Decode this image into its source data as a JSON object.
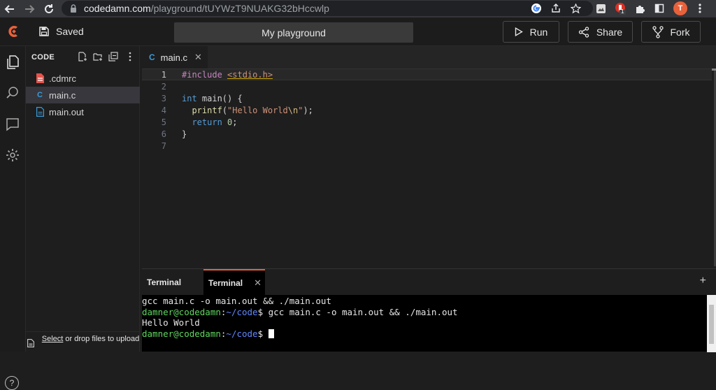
{
  "browser": {
    "url_host": "codedamn.com",
    "url_path": "/playground/tUYWzT9NUAKG32bHccwlp",
    "avatar_letter": "T",
    "extension_badge": "1"
  },
  "header": {
    "saved_label": "Saved",
    "title": "My playground",
    "run_label": "Run",
    "share_label": "Share",
    "fork_label": "Fork"
  },
  "explorer": {
    "title": "CODE",
    "files": [
      {
        "name": ".cdmrc",
        "icon": "file-red-icon"
      },
      {
        "name": "main.c",
        "icon": "c-file-icon"
      },
      {
        "name": "main.out",
        "icon": "file-blue-icon"
      }
    ],
    "upload_link": "Select",
    "upload_text": " or drop files to upload"
  },
  "editor": {
    "tab_label": "main.c",
    "line_numbers": [
      "1",
      "2",
      "3",
      "4",
      "5",
      "6",
      "7"
    ],
    "code": {
      "l1_pp": "#include ",
      "l1_inc": "<stdio.h>",
      "l3_kw": "int",
      "l3_rest": " main() {",
      "l4_fn": "printf",
      "l4_open": "(",
      "l4_str": "\"Hello World",
      "l4_esc": "\\n",
      "l4_strend": "\"",
      "l4_close": ");",
      "l5_kw": "return",
      "l5_num": "0",
      "l5_end": ";",
      "l6": "}"
    }
  },
  "terminal": {
    "tab1_label": "Terminal",
    "tab2_label": "Terminal",
    "line1": "gcc main.c -o main.out && ./main.out",
    "prompt_user": "damner@codedamn",
    "prompt_sep": ":",
    "prompt_path": "~/code",
    "prompt_dollar": "$ ",
    "line2_cmd": "gcc main.c -o main.out && ./main.out",
    "output": "Hello World"
  },
  "colors": {
    "brand": "#e8613b",
    "keyword": "#569cd6",
    "prompt_user": "#5fd75f",
    "prompt_path": "#5f87ff"
  }
}
